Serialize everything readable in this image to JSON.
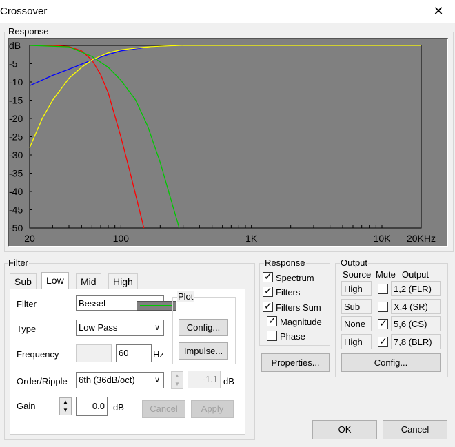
{
  "window": {
    "title": "Crossover"
  },
  "response_group": {
    "label": "Response"
  },
  "chart_data": {
    "type": "line",
    "ylabel": "dB",
    "xlim": [
      20,
      20000
    ],
    "ylim": [
      -50,
      0
    ],
    "x_scale": "log",
    "y_ticks": [
      "dB",
      "-5",
      "-10",
      "-15",
      "-20",
      "-25",
      "-30",
      "-35",
      "-40",
      "-45",
      "-50"
    ],
    "x_ticks": [
      "20",
      "100",
      "1K",
      "10K",
      "20KHz"
    ],
    "x_tick_values": [
      20,
      100,
      1000,
      10000,
      20000
    ],
    "series": [
      {
        "color": "#ff0000",
        "x": [
          20,
          30,
          40,
          50,
          60,
          70,
          80,
          100,
          120,
          150
        ],
        "y": [
          0,
          0,
          -0.3,
          -1.5,
          -4,
          -8,
          -13,
          -25,
          -36,
          -50
        ]
      },
      {
        "color": "#00c800",
        "x": [
          20,
          40,
          60,
          80,
          100,
          130,
          160,
          200,
          250,
          280
        ],
        "y": [
          0,
          -0.4,
          -3,
          -6,
          -9.5,
          -15,
          -22,
          -32,
          -44,
          -50
        ]
      },
      {
        "color": "#0000ff",
        "x": [
          20,
          30,
          40,
          60,
          80,
          100,
          150,
          200,
          300
        ],
        "y": [
          -11,
          -8.2,
          -6.5,
          -4,
          -2.5,
          -1.5,
          -0.6,
          -0.2,
          0
        ]
      },
      {
        "color": "#ffff00",
        "x": [
          20,
          25,
          30,
          40,
          50,
          60,
          80,
          100,
          150,
          200,
          300,
          1000,
          20000
        ],
        "y": [
          -28,
          -20,
          -15,
          -9,
          -6,
          -4,
          -2,
          -1.2,
          -0.5,
          -0.2,
          0,
          0,
          0
        ]
      }
    ]
  },
  "filter_group": {
    "label": "Filter"
  },
  "tabs": [
    {
      "label": "Sub"
    },
    {
      "label": "Low"
    },
    {
      "label": "Mid"
    },
    {
      "label": "High"
    }
  ],
  "filter_panel": {
    "filter_label": "Filter",
    "filter_value": "Bessel",
    "type_label": "Type",
    "type_value": "Low Pass",
    "frequency_label": "Frequency",
    "frequency_value": "60",
    "frequency_unit": "Hz",
    "order_label": "Order/Ripple",
    "order_value": "6th (36dB/oct)",
    "ripple_value": "-1.1",
    "ripple_unit": "dB",
    "gain_label": "Gain",
    "gain_value": "0.0",
    "gain_unit": "dB",
    "plot_label": "Plot",
    "plot_color": "#00c800",
    "config_button": "Config...",
    "impulse_button": "Impulse...",
    "cancel_button": "Cancel",
    "apply_button": "Apply"
  },
  "response_options": {
    "label": "Response",
    "items": [
      {
        "label": "Spectrum",
        "checked": true
      },
      {
        "label": "Filters",
        "checked": true
      },
      {
        "label": "Filters Sum",
        "checked": true
      },
      {
        "label": "Magnitude",
        "checked": true
      },
      {
        "label": "Phase",
        "checked": false
      }
    ],
    "properties_button": "Properties..."
  },
  "output": {
    "label": "Output",
    "headers": [
      "Source",
      "Mute",
      "Output"
    ],
    "rows": [
      {
        "source": "High",
        "mute": false,
        "output": "1,2 (FLR)"
      },
      {
        "source": "Sub",
        "mute": false,
        "output": "X,4 (SR)"
      },
      {
        "source": "None",
        "mute": true,
        "output": "5,6 (CS)"
      },
      {
        "source": "High",
        "mute": true,
        "output": "7,8 (BLR)"
      }
    ],
    "config_button": "Config..."
  },
  "dialog": {
    "ok_button": "OK",
    "cancel_button": "Cancel"
  },
  "icons": {
    "close": "close-icon",
    "check": "check-icon",
    "dropdown": "chevron-down-icon",
    "spin_up": "spin-up-icon",
    "spin_down": "spin-down-icon"
  }
}
